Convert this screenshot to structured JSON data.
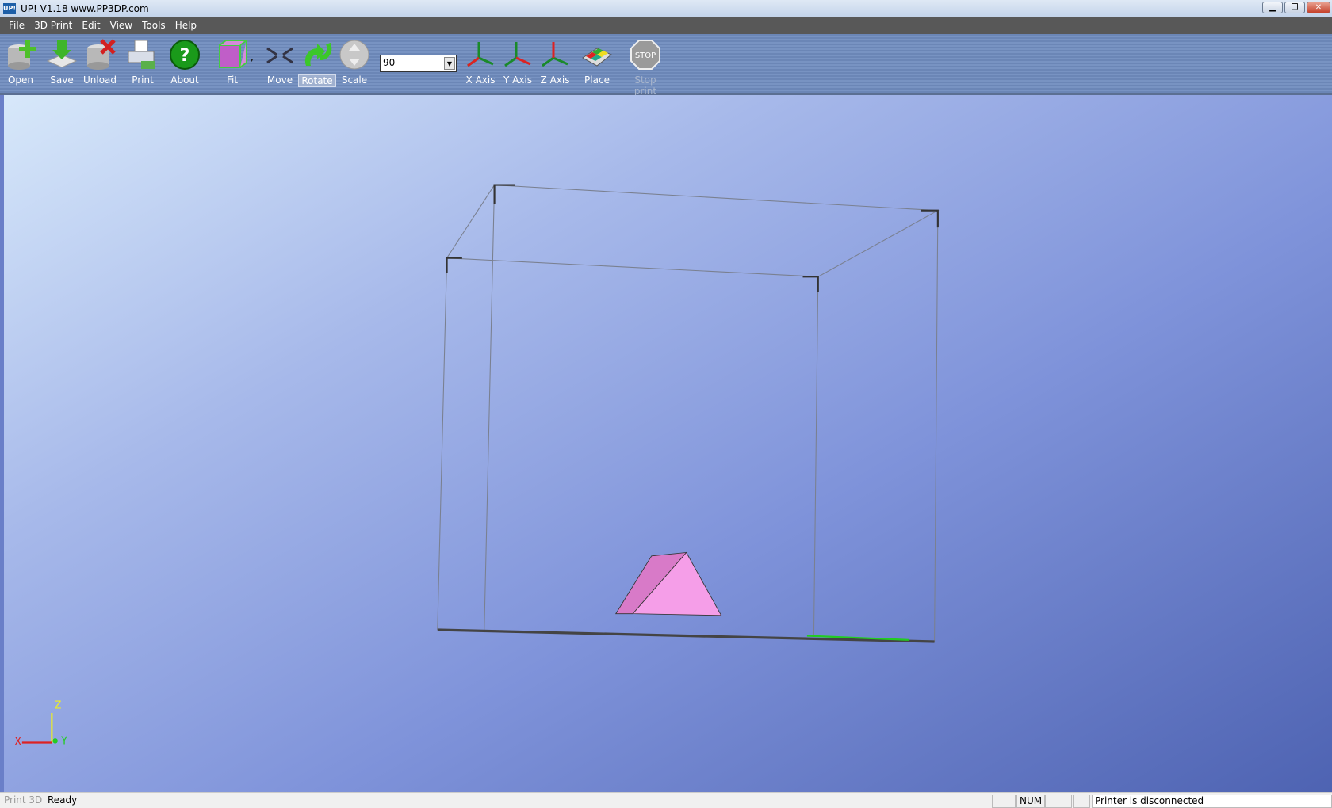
{
  "window": {
    "title": "UP!  V1.18  www.PP3DP.com",
    "logo": "UP!",
    "controls": [
      "minimize",
      "restore",
      "close"
    ]
  },
  "menu": [
    "File",
    "3D Print",
    "Edit",
    "View",
    "Tools",
    "Help"
  ],
  "toolbar": {
    "buttons": [
      {
        "id": "open",
        "label": "Open",
        "icon": "open-icon"
      },
      {
        "id": "save",
        "label": "Save",
        "icon": "save-icon"
      },
      {
        "id": "unload",
        "label": "Unload",
        "icon": "unload-icon"
      },
      {
        "id": "print",
        "label": "Print",
        "icon": "printer-icon"
      },
      {
        "id": "about",
        "label": "About",
        "icon": "help-icon"
      },
      {
        "id": "fit",
        "label": "Fit",
        "icon": "fit-cube-icon"
      },
      {
        "id": "move",
        "label": "Move",
        "icon": "move-arrows-icon"
      },
      {
        "id": "rotate",
        "label": "Rotate",
        "icon": "rotate-icon",
        "selected": true
      },
      {
        "id": "scale",
        "label": "Scale",
        "icon": "scale-icon"
      },
      {
        "id": "xaxis",
        "label": "X Axis",
        "icon": "x-axis-icon"
      },
      {
        "id": "yaxis",
        "label": "Y Axis",
        "icon": "y-axis-icon"
      },
      {
        "id": "zaxis",
        "label": "Z Axis",
        "icon": "z-axis-icon"
      },
      {
        "id": "place",
        "label": "Place",
        "icon": "place-icon"
      },
      {
        "id": "stop",
        "label": "Stop print",
        "icon": "stop-icon",
        "disabled": true
      }
    ],
    "angle_value": "90"
  },
  "viewport": {
    "axes_labels": {
      "x": "X",
      "y": "Y",
      "z": "Z"
    },
    "model_color": "#f59ee8",
    "stop_text": "STOP"
  },
  "statusbar": {
    "tab": "Print 3D",
    "status": "Ready",
    "num": "NUM",
    "printer": "Printer is disconnected"
  }
}
